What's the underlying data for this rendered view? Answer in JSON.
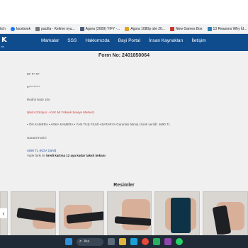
{
  "bookmarks": [
    {
      "label": "itch",
      "color": "#fa5c5c"
    },
    {
      "label": "facebook",
      "color": "#1877f2"
    },
    {
      "label": "pacilla - Kelime oyu...",
      "color": "#777777"
    },
    {
      "label": "Agora (2009) YIFY -...",
      "color": "#4b5b7a"
    },
    {
      "label": "Agora 1080p izle 20...",
      "color": "#e0a12a"
    },
    {
      "label": "New Games Box",
      "color": "#c0392b"
    },
    {
      "label": "13 Reasons Why İd...",
      "color": "#2980b9"
    }
  ],
  "header": {
    "logo": "K",
    "logo_sub": "vis",
    "nav": [
      "Markalar",
      "SSS",
      "Hakkımızda",
      "Bayi Portal",
      "İnsan Kaynakları",
      "İletişim"
    ]
  },
  "form": {
    "title": "Form No: 2401850064",
    "customer_name": "M* F* O*",
    "phone": "5*********",
    "device": "Redmi Note 10s",
    "service_center": "İşlem Görüyor - KVK Mi Yüksek Seviye Merkezi",
    "operations": "• ÖN KAMERA • ARKA KAMERA • YAN TUŞ FİLMİ • BATARYA Garantisi bitmiş Ücreti verildi: 4690 TL",
    "warranty": "Garanti Harici",
    "price": "4690 TL (KDV Dahil)",
    "installment_prefix": "Vade farkı ile",
    "installment_bold": "kredi kartına 12 aya kadar taksit imkanı"
  },
  "gallery": {
    "title": "Resimler",
    "prev_label": "‹"
  },
  "taskbar": {
    "search_placeholder": "Ara"
  },
  "colors": {
    "header_bg": "#0f4c8e",
    "accent_red": "#d23b3b",
    "link_blue": "#2a55a0"
  }
}
